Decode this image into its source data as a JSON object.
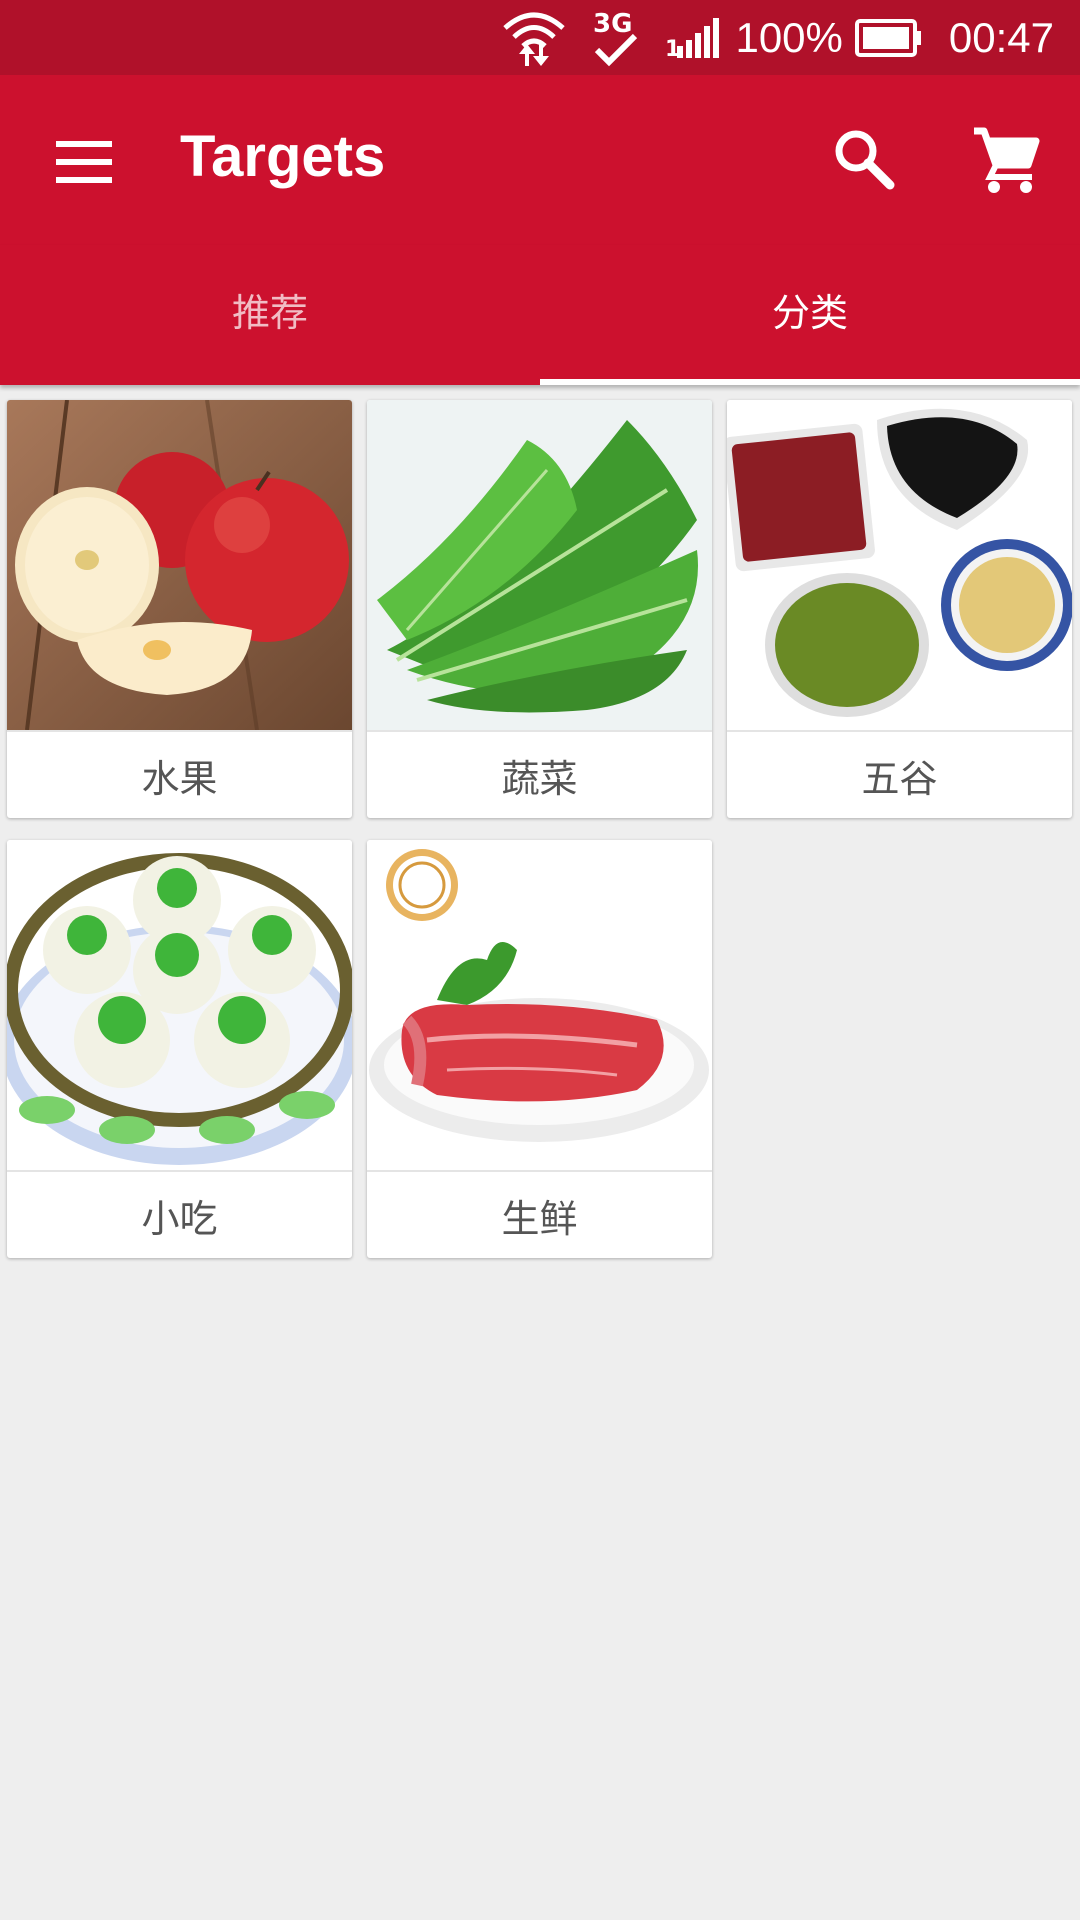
{
  "status_bar": {
    "battery": "100%",
    "time": "00:47",
    "network": "3G",
    "icons": [
      "wifi-icon",
      "network-3g-icon",
      "signal-icon",
      "battery-icon"
    ]
  },
  "toolbar": {
    "title": "Targets",
    "icons": [
      "menu-icon",
      "search-icon",
      "cart-icon"
    ]
  },
  "tabs": [
    {
      "label": "推荐",
      "active": false
    },
    {
      "label": "分类",
      "active": true
    }
  ],
  "categories": [
    {
      "label": "水果",
      "image": "apples"
    },
    {
      "label": "蔬菜",
      "image": "leafy-greens"
    },
    {
      "label": "五谷",
      "image": "grains-beans"
    },
    {
      "label": "小吃",
      "image": "steamed-buns"
    },
    {
      "label": "生鲜",
      "image": "raw-steak"
    }
  ],
  "colors": {
    "status_bar": "#b0112a",
    "primary": "#cc112e",
    "background": "#eeeeee"
  }
}
